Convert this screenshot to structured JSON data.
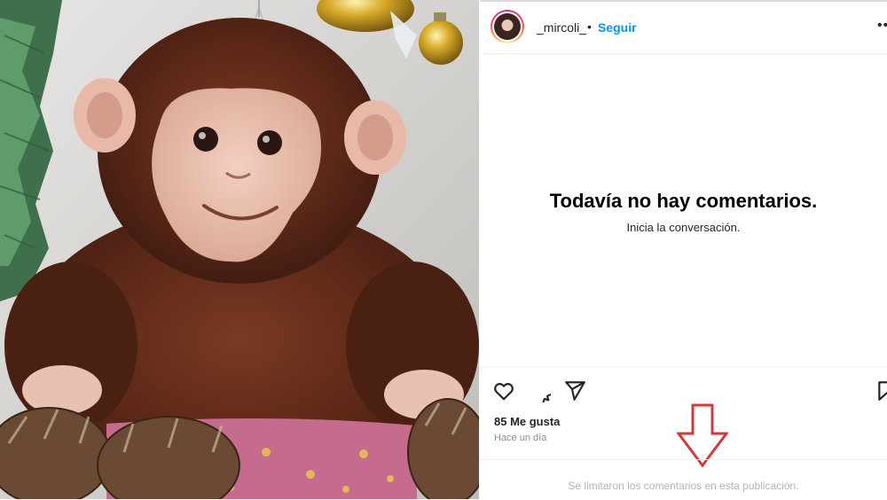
{
  "post": {
    "username": "_mircoli_",
    "separator": "•",
    "follow_label": "Seguir",
    "more_label": "•••"
  },
  "comments": {
    "empty_title": "Todavía no hay comentarios.",
    "empty_subtitle": "Inicia la conversación.",
    "limited_notice": "Se limitaron los comentarios en esta publicación."
  },
  "engagement": {
    "likes_label": "85 Me gusta",
    "time_ago": "Hace un día"
  },
  "icons": {
    "like": "heart-icon",
    "comment": "comment-icon",
    "share": "send-icon",
    "save": "bookmark-icon",
    "annotation": "down-arrow-annotation"
  },
  "colors": {
    "link": "#0095f6",
    "annotation_arrow": "#d03a3a"
  }
}
